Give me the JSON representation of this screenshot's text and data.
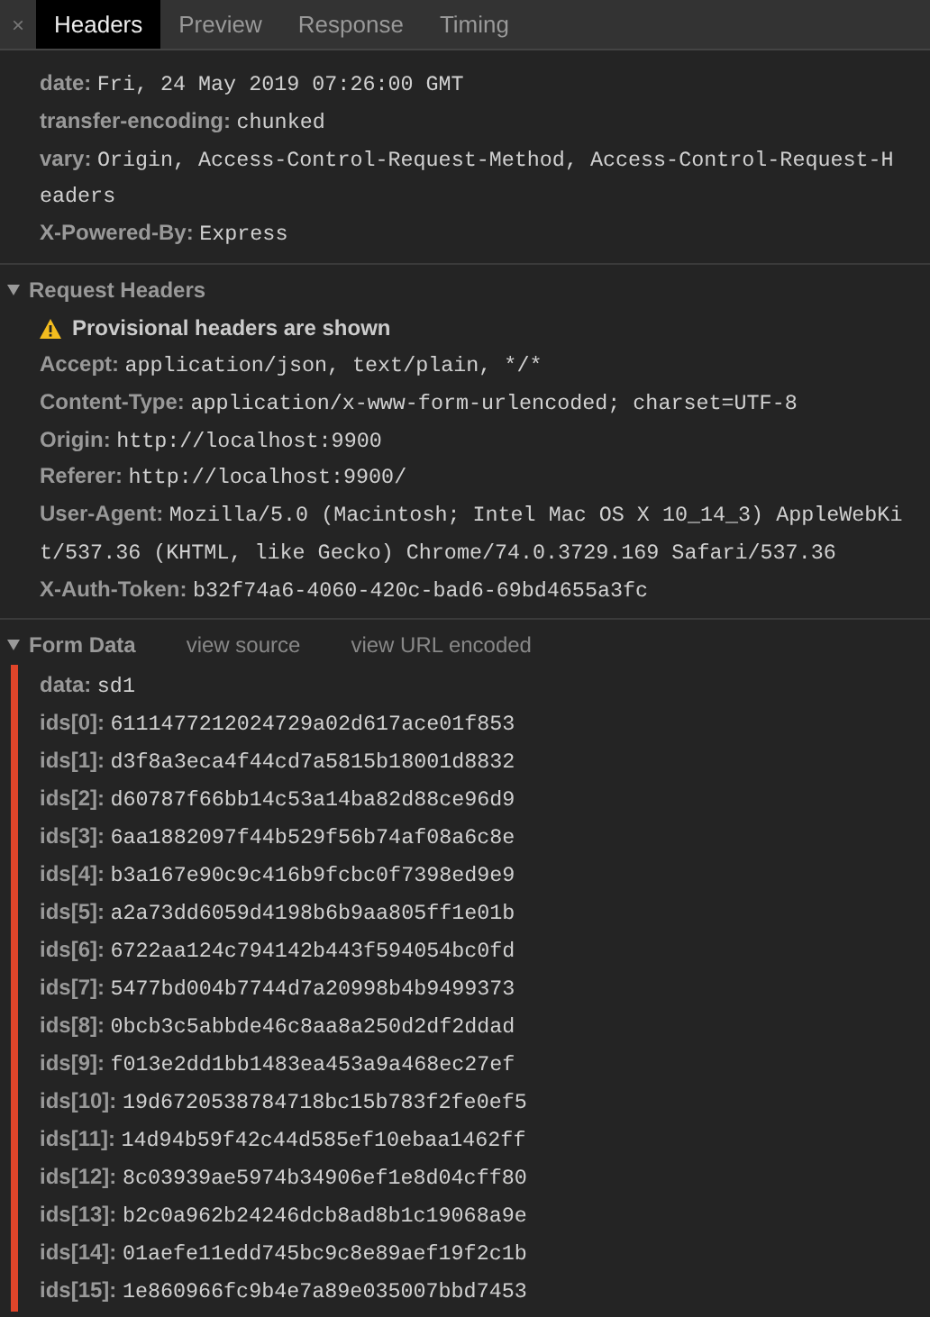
{
  "tab_bar": {
    "close": "×",
    "tabs": [
      {
        "label": "Headers",
        "selected": true
      },
      {
        "label": "Preview",
        "selected": false
      },
      {
        "label": "Response",
        "selected": false
      },
      {
        "label": "Timing",
        "selected": false
      }
    ]
  },
  "response_headers": [
    {
      "name": "date:",
      "value": "Fri, 24 May 2019 07:26:00 GMT"
    },
    {
      "name": "transfer-encoding:",
      "value": "chunked"
    },
    {
      "name": "vary:",
      "value": "Origin, Access-Control-Request-Method, Access-Control-Request-Headers"
    },
    {
      "name": "X-Powered-By:",
      "value": "Express"
    }
  ],
  "request_headers": {
    "title": "Request Headers",
    "expanded": true,
    "warning": "Provisional headers are shown",
    "headers": [
      {
        "name": "Accept:",
        "value": "application/json, text/plain, */*"
      },
      {
        "name": "Content-Type:",
        "value": "application/x-www-form-urlencoded; charset=UTF-8"
      },
      {
        "name": "Origin:",
        "value": "http://localhost:9900"
      },
      {
        "name": "Referer:",
        "value": "http://localhost:9900/"
      },
      {
        "name": "User-Agent:",
        "value": "Mozilla/5.0 (Macintosh; Intel Mac OS X 10_14_3) AppleWebKit/537.36 (KHTML, like Gecko) Chrome/74.0.3729.169 Safari/537.36"
      },
      {
        "name": "X-Auth-Token:",
        "value": "b32f74a6-4060-420c-bad6-69bd4655a3fc"
      }
    ]
  },
  "form_data": {
    "title": "Form Data",
    "expanded": true,
    "links": [
      "view source",
      "view URL encoded"
    ],
    "fields": [
      {
        "name": "data:",
        "value": "sd1"
      },
      {
        "name": "ids[0]:",
        "value": "6111477212024729a02d617ace01f853"
      },
      {
        "name": "ids[1]:",
        "value": "d3f8a3eca4f44cd7a5815b18001d8832"
      },
      {
        "name": "ids[2]:",
        "value": "d60787f66bb14c53a14ba82d88ce96d9"
      },
      {
        "name": "ids[3]:",
        "value": "6aa1882097f44b529f56b74af08a6c8e"
      },
      {
        "name": "ids[4]:",
        "value": "b3a167e90c9c416b9fcbc0f7398ed9e9"
      },
      {
        "name": "ids[5]:",
        "value": "a2a73dd6059d4198b6b9aa805ff1e01b"
      },
      {
        "name": "ids[6]:",
        "value": "6722aa124c794142b443f594054bc0fd"
      },
      {
        "name": "ids[7]:",
        "value": "5477bd004b7744d7a20998b4b9499373"
      },
      {
        "name": "ids[8]:",
        "value": "0bcb3c5abbde46c8aa8a250d2df2ddad"
      },
      {
        "name": "ids[9]:",
        "value": "f013e2dd1bb1483ea453a9a468ec27ef"
      },
      {
        "name": "ids[10]:",
        "value": "19d6720538784718bc15b783f2fe0ef5"
      },
      {
        "name": "ids[11]:",
        "value": "14d94b59f42c44d585ef10ebaa1462ff"
      },
      {
        "name": "ids[12]:",
        "value": "8c03939ae5974b34906ef1e8d04cff80"
      },
      {
        "name": "ids[13]:",
        "value": "b2c0a962b24246dcb8ad8b1c19068a9e"
      },
      {
        "name": "ids[14]:",
        "value": "01aefe11edd745bc9c8e89aef19f2c1b"
      },
      {
        "name": "ids[15]:",
        "value": "1e860966fc9b4e7a89e035007bbd7453"
      }
    ]
  }
}
